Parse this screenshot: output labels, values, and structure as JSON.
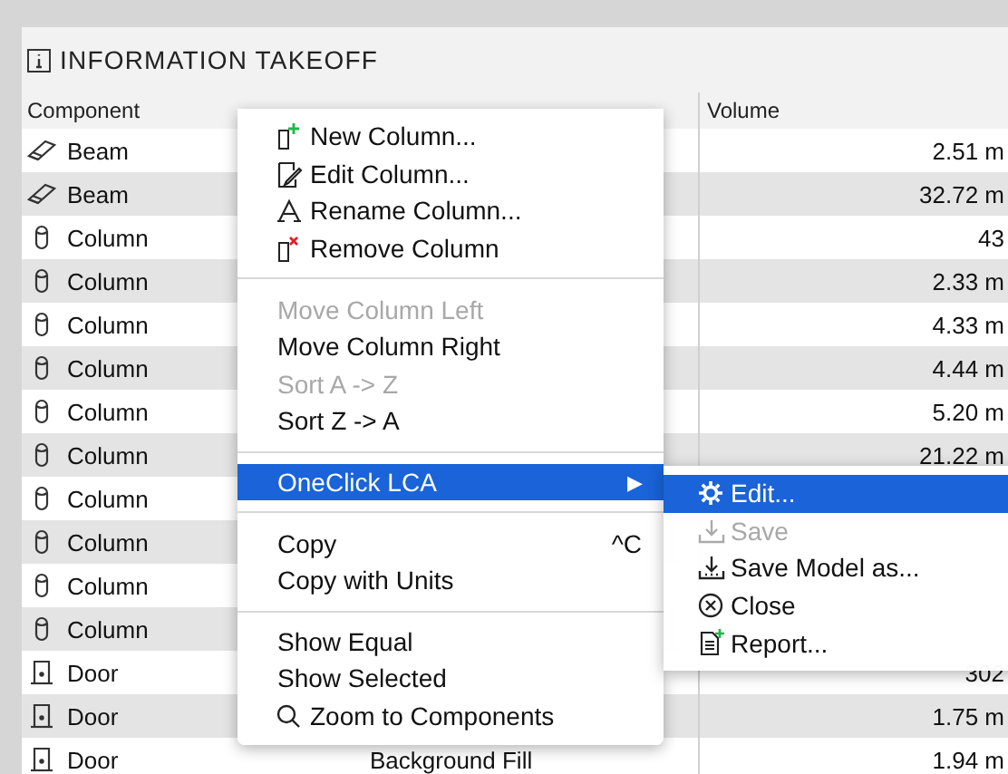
{
  "panel": {
    "title": "INFORMATION TAKEOFF"
  },
  "table": {
    "columns": [
      {
        "label": "Component"
      },
      {
        "label": "Volume"
      }
    ],
    "rows": [
      {
        "kind": "beam",
        "component": "Beam",
        "volume": "2.51 m"
      },
      {
        "kind": "beam",
        "component": "Beam",
        "volume": "32.72 m"
      },
      {
        "kind": "column",
        "component": "Column",
        "volume": "43"
      },
      {
        "kind": "column",
        "component": "Column",
        "volume": "2.33 m"
      },
      {
        "kind": "column",
        "component": "Column",
        "volume": "4.33 m"
      },
      {
        "kind": "column",
        "component": "Column",
        "volume": "4.44 m"
      },
      {
        "kind": "column",
        "component": "Column",
        "volume": "5.20 m"
      },
      {
        "kind": "column",
        "component": "Column",
        "volume": "21.22 m"
      },
      {
        "kind": "column",
        "component": "Column"
      },
      {
        "kind": "column",
        "component": "Column"
      },
      {
        "kind": "column",
        "component": "Column"
      },
      {
        "kind": "column",
        "component": "Column"
      },
      {
        "kind": "door",
        "component": "Door",
        "volume": "302"
      },
      {
        "kind": "door",
        "component": "Door",
        "volume": "1.75 m"
      },
      {
        "kind": "door",
        "component": "Door",
        "material": "Background Fill",
        "volume": "1.94 m"
      }
    ]
  },
  "context_menu": {
    "items": [
      {
        "kind": "item",
        "label": "New Column...",
        "disabled": false,
        "selected": false
      },
      {
        "kind": "item",
        "label": "Edit Column...",
        "disabled": false,
        "selected": false
      },
      {
        "kind": "item",
        "label": "Rename Column...",
        "disabled": false,
        "selected": false
      },
      {
        "kind": "item",
        "label": "Remove Column",
        "disabled": false,
        "selected": false
      },
      {
        "kind": "separator"
      },
      {
        "kind": "item",
        "label": "Move Column Left",
        "disabled": true,
        "selected": false
      },
      {
        "kind": "item",
        "label": "Move Column Right",
        "disabled": false,
        "selected": false
      },
      {
        "kind": "item",
        "label": "Sort A -> Z",
        "disabled": true,
        "selected": false
      },
      {
        "kind": "item",
        "label": "Sort Z -> A",
        "disabled": false,
        "selected": false
      },
      {
        "kind": "separator"
      },
      {
        "kind": "item",
        "label": "OneClick LCA",
        "submenu_arrow": "▶",
        "disabled": false,
        "selected": true
      },
      {
        "kind": "separator"
      },
      {
        "kind": "item",
        "label": "Copy",
        "shortcut": "^C",
        "disabled": false,
        "selected": false
      },
      {
        "kind": "item",
        "label": "Copy with Units",
        "disabled": false,
        "selected": false
      },
      {
        "kind": "separator"
      },
      {
        "kind": "item",
        "label": "Show Equal",
        "disabled": false,
        "selected": false
      },
      {
        "kind": "item",
        "label": "Show Selected",
        "disabled": false,
        "selected": false
      },
      {
        "kind": "item",
        "label": "Zoom to Components",
        "disabled": false,
        "selected": false
      }
    ]
  },
  "submenu": {
    "items": [
      {
        "kind": "item",
        "label": "Edit...",
        "disabled": false,
        "selected": true
      },
      {
        "kind": "item",
        "label": "Save",
        "disabled": true,
        "selected": false
      },
      {
        "kind": "item",
        "label": "Save Model as...",
        "disabled": false,
        "selected": false
      },
      {
        "kind": "item",
        "label": "Close",
        "disabled": false,
        "selected": false
      },
      {
        "kind": "item",
        "label": "Report...",
        "disabled": false,
        "selected": false
      }
    ]
  }
}
